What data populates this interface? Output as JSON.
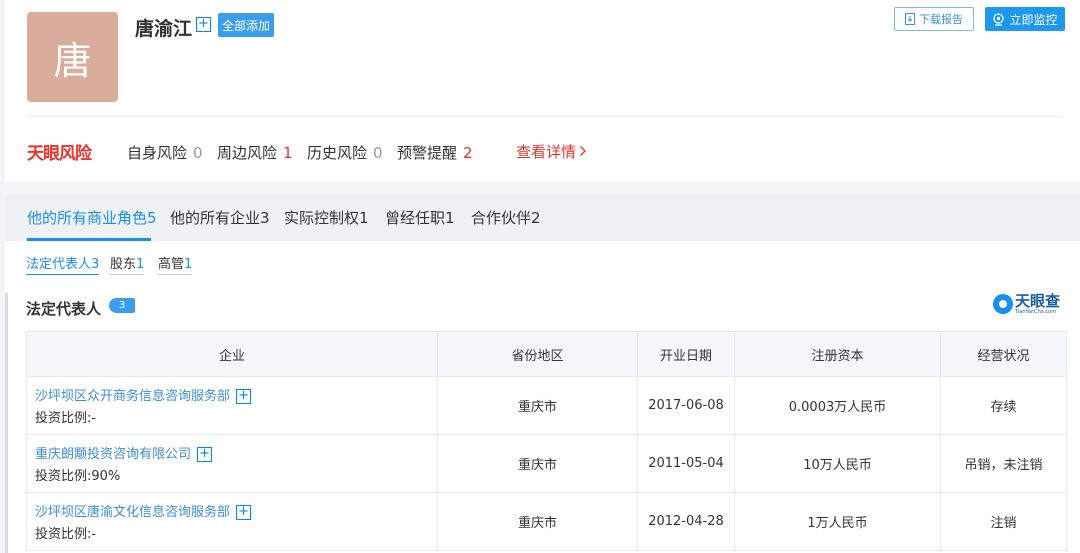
{
  "header": {
    "avatar_char": "唐",
    "name": "唐渝江",
    "plus_glyph": "+",
    "add_all_label": "全部添加",
    "download_label": "下载报告",
    "monitor_label": "立即监控"
  },
  "risk": {
    "logo": "天眼风险",
    "items": [
      {
        "label": "自身风险",
        "count": "0"
      },
      {
        "label": "周边风险",
        "count": "1"
      },
      {
        "label": "历史风险",
        "count": "0"
      },
      {
        "label": "预警提醒",
        "count": "2"
      }
    ],
    "link_label": "查看详情"
  },
  "tabs": [
    {
      "label": "他的所有商业角色5"
    },
    {
      "label": "他的所有企业3"
    },
    {
      "label": "实际控制权1"
    },
    {
      "label": "曾经任职1"
    },
    {
      "label": "合作伙伴2"
    }
  ],
  "subtabs": [
    {
      "label": "法定代表人",
      "count": "3"
    },
    {
      "label": "股东",
      "count": "1"
    },
    {
      "label": "高管",
      "count": "1"
    }
  ],
  "section": {
    "title": "法定代表人",
    "count": "3",
    "brand_cn": "天眼查",
    "brand_en": "TianYanCha.com"
  },
  "table": {
    "headers": [
      "企业",
      "省份地区",
      "开业日期",
      "注册资本",
      "经营状况"
    ],
    "rows": [
      {
        "company": "沙坪坝区众开商务信息咨询服务部",
        "ratio": "投资比例:-",
        "region": "重庆市",
        "date": "2017-06-08",
        "capital": "0.0003万人民币",
        "status": "存续"
      },
      {
        "company": "重庆朗颙投资咨询有限公司",
        "ratio": "投资比例:90%",
        "region": "重庆市",
        "date": "2011-05-04",
        "capital": "10万人民币",
        "status": "吊销，未注销"
      },
      {
        "company": "沙坪坝区唐渝文化信息咨询服务部",
        "ratio": "投资比例:-",
        "region": "重庆市",
        "date": "2012-04-28",
        "capital": "1万人民币",
        "status": "注销"
      }
    ]
  },
  "colors": {
    "accent": "#1a8ff0",
    "risk_red": "#e8362c",
    "avatar_bg": "#d9ac9c"
  }
}
